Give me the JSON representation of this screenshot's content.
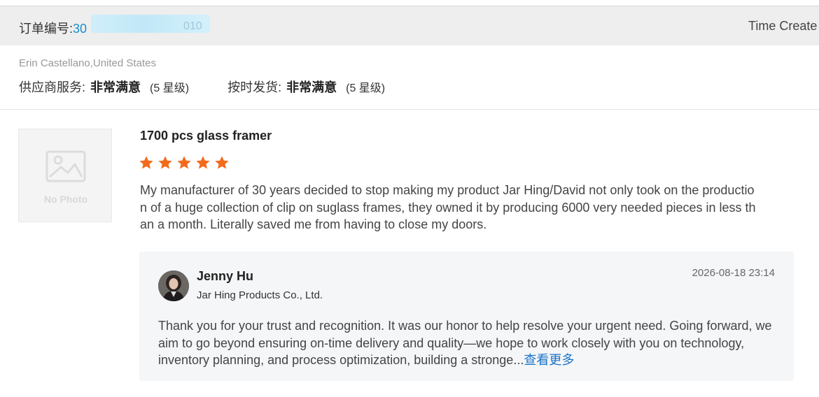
{
  "order": {
    "label": "订单编号:",
    "number_visible_prefix": "30",
    "number_visible_suffix": "010"
  },
  "header": {
    "time_created_label": "Time Create"
  },
  "buyer": {
    "name_country": "Erin Castellano,United States"
  },
  "ratings": [
    {
      "label": "供应商服务:",
      "value": "非常满意",
      "stars_text": "(5 星级)"
    },
    {
      "label": "按时发货:",
      "value": "非常满意",
      "stars_text": "(5 星级)"
    }
  ],
  "photo": {
    "placeholder_text": "No Photo",
    "icon": "image-placeholder-icon"
  },
  "review": {
    "product_title": "1700 pcs glass framer",
    "star_rating": 5,
    "star_color": "#f26b1d",
    "text": "My manufacturer of 30 years decided to stop making my product Jar Hing/David not only took on the production of a huge collection of clip on suglass frames, they owned it by producing 6000 very needed pieces in less than a month. Literally saved me from having to close my doors."
  },
  "reply": {
    "name": "Jenny Hu",
    "company": "Jar Hing Products Co., Ltd.",
    "date": "2026-08-18 23:14",
    "text": "Thank you for your trust and recognition. It was our honor to help resolve your urgent need. Going forward, we aim to go beyond ensuring on-time delivery and quality—we hope to work closely with you on technology, inventory planning, and process optimization, building a stronge...",
    "see_more": "查看更多"
  },
  "colors": {
    "link_blue": "#1a73c9",
    "order_blue": "#1a8ec9",
    "header_bg": "#eeeeee",
    "reply_bg": "#f4f6f8"
  }
}
